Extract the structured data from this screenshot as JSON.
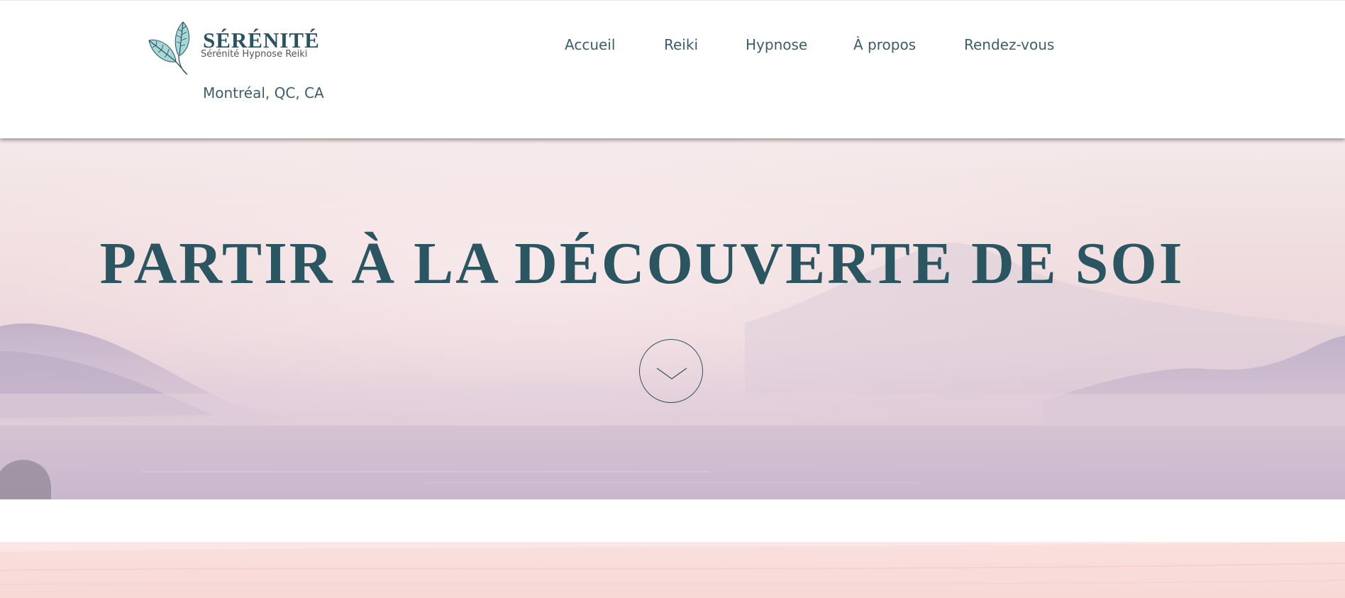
{
  "header": {
    "logo": {
      "title": "SÉRÉNITÉ",
      "subtitle": "Sérénité Hypnose Reiki",
      "icon": "leaves-icon"
    },
    "location": "Montréal, QC, CA",
    "nav": [
      {
        "label": "Accueil"
      },
      {
        "label": "Reiki"
      },
      {
        "label": "Hypnose"
      },
      {
        "label": "À propos"
      },
      {
        "label": "Rendez-vous"
      }
    ]
  },
  "hero": {
    "title": "PARTIR À LA DÉCOUVERTE DE SOI",
    "scroll_icon": "chevron-down-icon"
  },
  "colors": {
    "brand": "#2b5561",
    "nav_text": "#3d5d6b",
    "leaf": "#9fd3d6",
    "hero_top": "#f4e9ea",
    "hero_bottom": "#cdbdd1",
    "section_pink": "#f9dedc"
  }
}
